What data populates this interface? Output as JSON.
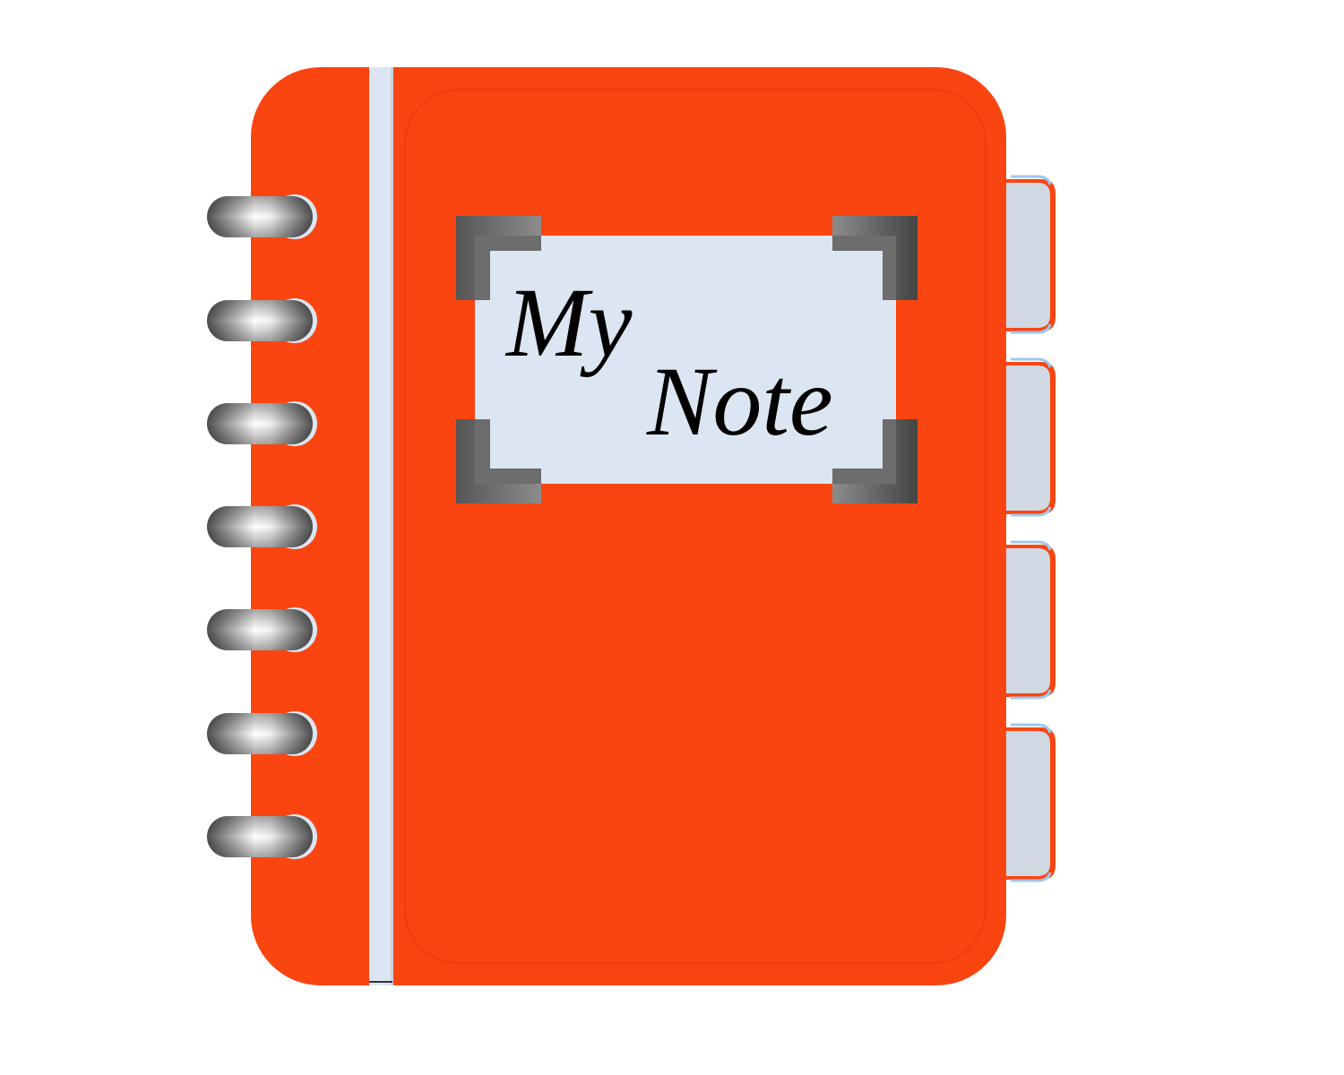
{
  "label": {
    "line1": "My",
    "line2": "Note"
  },
  "colors": {
    "cover": "#fa4511",
    "cover_edge": "#f03d0c",
    "spine_strip": "#dce6f2",
    "label_bg": "#dce6f2",
    "corner": "#5a5a5a",
    "tab_bg": "#d0d8e4",
    "tab_edge": "#fa4511",
    "ring_dark": "#5e5e5e",
    "ring_light": "#ffffff"
  },
  "icons": {
    "rings": "spiral-binding-ring-icon",
    "corners": "photo-corner-icon",
    "tabs": "divider-tab-icon"
  },
  "ring_count": 7,
  "tab_count": 4
}
